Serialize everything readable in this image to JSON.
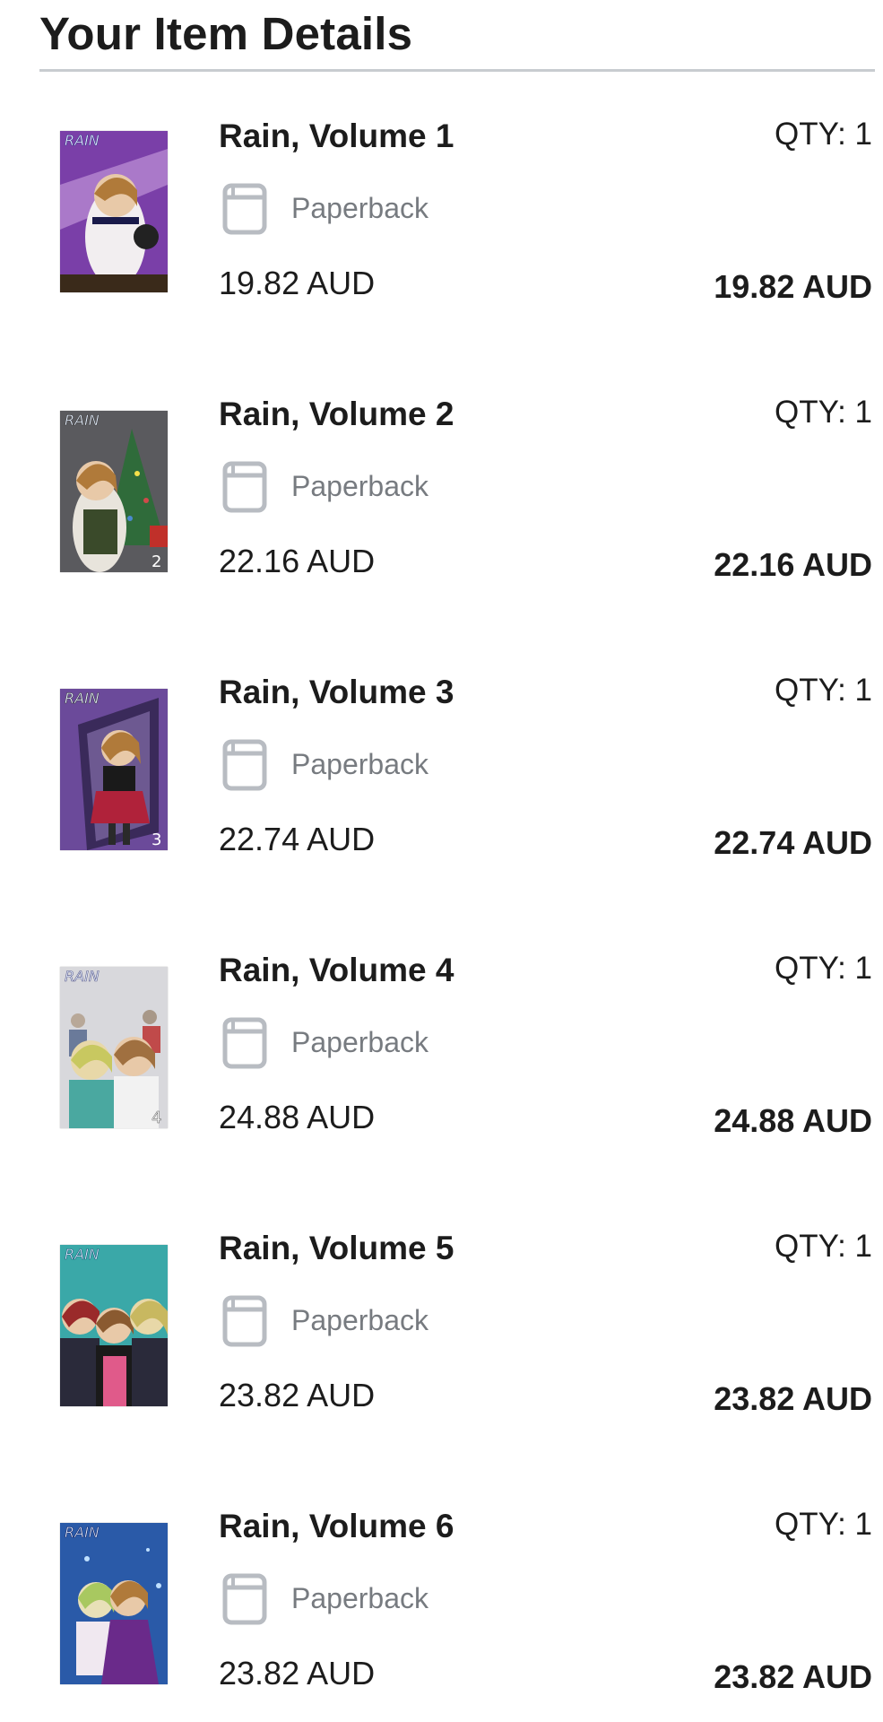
{
  "header": {
    "title": "Your Item Details"
  },
  "items": [
    {
      "title": "Rain, Volume 1",
      "qty_label": "QTY:",
      "qty": "1",
      "format": "Paperback",
      "format_icon": "book-icon",
      "unit_price": "19.82 AUD",
      "line_total": "19.82 AUD",
      "cover_title": "RAIN",
      "cover_colors": {
        "bg": "#7a3fa8",
        "accent": "#c9a0e0",
        "figure": "#e8c9a8"
      }
    },
    {
      "title": "Rain, Volume 2",
      "qty_label": "QTY:",
      "qty": "1",
      "format": "Paperback",
      "format_icon": "book-icon",
      "unit_price": "22.16 AUD",
      "line_total": "22.16 AUD",
      "cover_title": "RAIN",
      "cover_volume": "2",
      "cover_colors": {
        "bg": "#5a5a5e",
        "accent": "#2f6b3a",
        "figure": "#e8c9a8"
      }
    },
    {
      "title": "Rain, Volume 3",
      "qty_label": "QTY:",
      "qty": "1",
      "format": "Paperback",
      "format_icon": "book-icon",
      "unit_price": "22.74 AUD",
      "line_total": "22.74 AUD",
      "cover_title": "RAIN",
      "cover_volume": "3",
      "cover_colors": {
        "bg": "#6b4a9a",
        "accent": "#b0223a",
        "figure": "#e8c9a8"
      }
    },
    {
      "title": "Rain, Volume 4",
      "qty_label": "QTY:",
      "qty": "1",
      "format": "Paperback",
      "format_icon": "book-icon",
      "unit_price": "24.88 AUD",
      "line_total": "24.88 AUD",
      "cover_title": "RAIN",
      "cover_volume": "4",
      "cover_colors": {
        "bg": "#d8d8dc",
        "accent": "#4aa8a0",
        "figure": "#e8c9a8"
      }
    },
    {
      "title": "Rain, Volume 5",
      "qty_label": "QTY:",
      "qty": "1",
      "format": "Paperback",
      "format_icon": "book-icon",
      "unit_price": "23.82 AUD",
      "line_total": "23.82 AUD",
      "cover_title": "RAIN",
      "cover_colors": {
        "bg": "#3aa8a8",
        "accent": "#e05a8a",
        "figure": "#e8c9a8"
      }
    },
    {
      "title": "Rain, Volume 6",
      "qty_label": "QTY:",
      "qty": "1",
      "format": "Paperback",
      "format_icon": "book-icon",
      "unit_price": "23.82 AUD",
      "line_total": "23.82 AUD",
      "cover_title": "RAIN",
      "cover_colors": {
        "bg": "#2a5aa8",
        "accent": "#6a2a8a",
        "figure": "#e8c9a8"
      }
    }
  ]
}
